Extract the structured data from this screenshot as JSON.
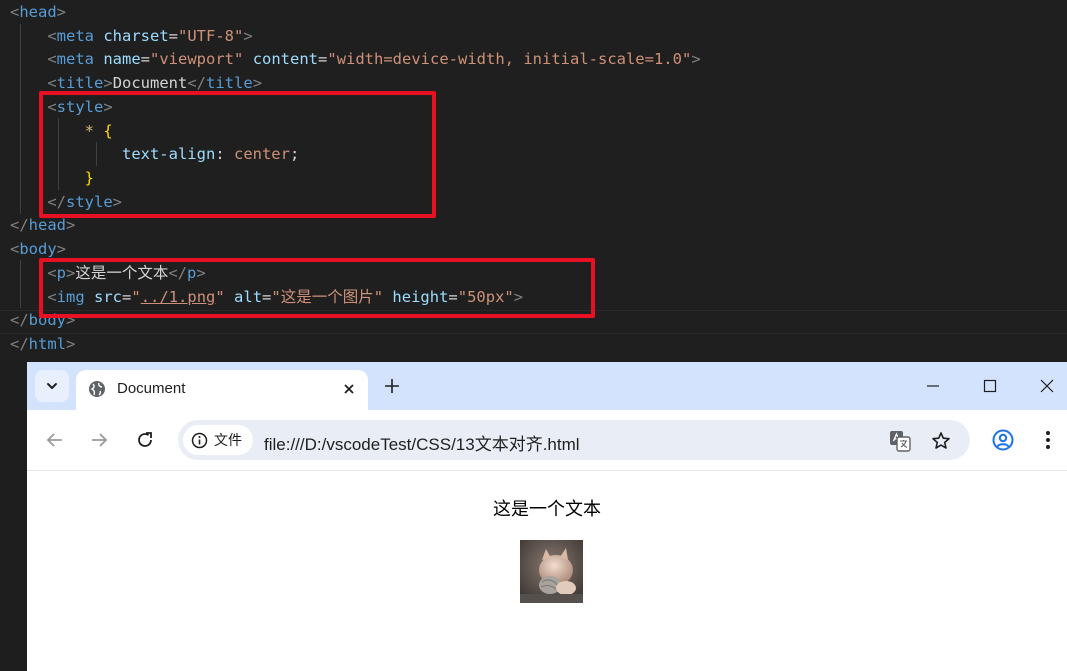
{
  "editor": {
    "lines": {
      "head_open": "head",
      "meta_charset": {
        "tag": "meta",
        "attr": "charset",
        "value": "\"UTF-8\""
      },
      "meta_viewport": {
        "tag": "meta",
        "attr1": "name",
        "value1": "\"viewport\"",
        "attr2": "content",
        "value2": "\"width=device-width, initial-scale=1.0\""
      },
      "title": {
        "tag": "title",
        "text": "Document"
      },
      "style_open": "style",
      "css_selector": "*",
      "css_open_brace": "{",
      "css_property": "text-align",
      "css_value": "center",
      "css_close_brace": "}",
      "style_close": "style",
      "head_close": "head",
      "body_open": "body",
      "p": {
        "tag": "p",
        "text": "这是一个文本"
      },
      "img": {
        "tag": "img",
        "attr1": "src",
        "value1_prefix": "\"",
        "value1_link": "../1.png",
        "value1_suffix": "\"",
        "attr2": "alt",
        "value2": "\"这是一个图片\"",
        "attr3": "height",
        "value3": "\"50px\""
      },
      "body_close": "body",
      "html_close": "html"
    },
    "highlight_color": "#e81123"
  },
  "browser": {
    "tab_title": "Document",
    "chip_label": "文件",
    "url": "file:///D:/vscodeTest/CSS/13文本对齐.html",
    "page": {
      "paragraph": "这是一个文本",
      "image_alt": "这是一个图片"
    },
    "icons": [
      "tab-search-icon",
      "globe-icon",
      "close-icon",
      "plus-icon",
      "minimize-icon",
      "maximize-icon",
      "window-close-icon",
      "back-icon",
      "forward-icon",
      "reload-icon",
      "info-icon",
      "translate-icon",
      "star-icon",
      "profile-icon",
      "menu-icon"
    ],
    "accent": "#1a73e8",
    "tabstrip_color": "#d3e3fd"
  }
}
